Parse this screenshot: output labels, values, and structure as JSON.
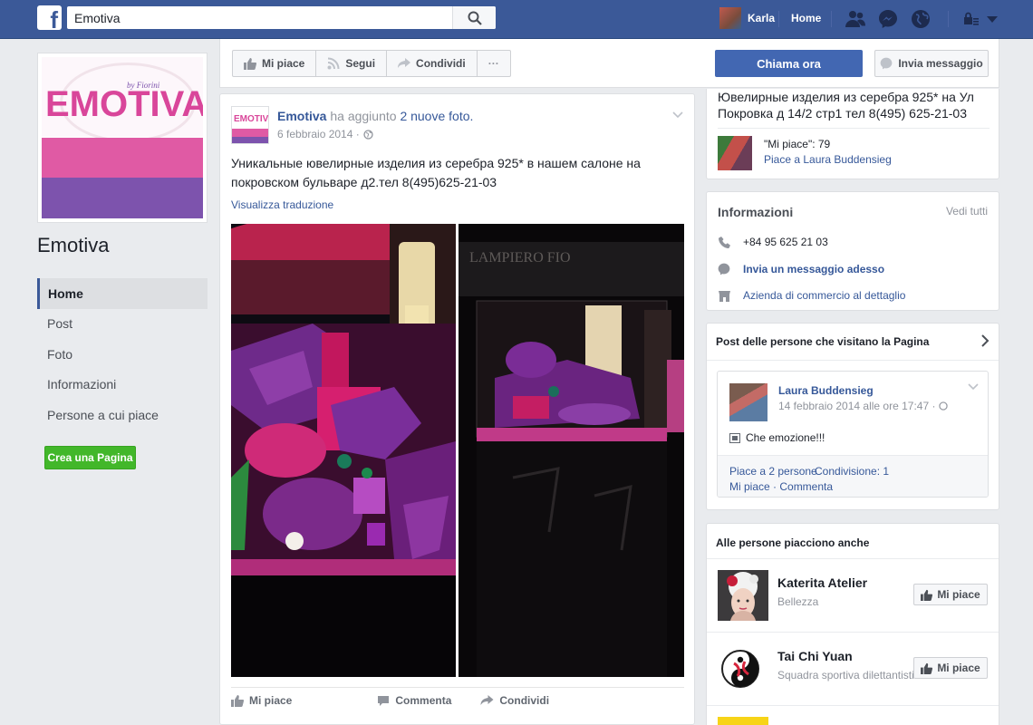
{
  "topbar": {
    "logo_letter": "f",
    "search_value": "Emotiva",
    "user_name": "Karla",
    "home_label": "Home",
    "colors": {
      "bar": "#3b5998"
    }
  },
  "left": {
    "logo_text": "EMOTIVA",
    "logo_by": "by Fiorini",
    "page_name": "Emotiva",
    "nav": [
      "Home",
      "Post",
      "Foto",
      "Informazioni",
      "Persone a cui piace"
    ],
    "create_page": "Crea una Pagina"
  },
  "actionbar": {
    "like": "Mi piace",
    "follow": "Segui",
    "share": "Condividi",
    "more": "···",
    "call": "Chiama ora",
    "message": "Invia messaggio"
  },
  "post": {
    "author": "Emotiva",
    "added": "ha aggiunto",
    "photos_link": "2 nuove foto.",
    "date": "6 febbraio 2014 ·",
    "text": "Уникальные ювелирные изделия из серебра 925* в нашем салоне на покровском бульваре д2.тел 8(495)625-21-03",
    "translate": "Visualizza traduzione",
    "actions": {
      "like": "Mi piace",
      "comment": "Commenta",
      "share": "Condividi"
    }
  },
  "right": {
    "address": "Ювелирные изделия из серебра 925* на Ул Покровка д 14/2 стр1 тел 8(495) 625-21-03",
    "likes_count": "\"Mi piace\": 79",
    "likes_by": "Piace a Laura Buddensieg",
    "info": {
      "title": "Informazioni",
      "see_all": "Vedi tutti",
      "phone": "+84 95 625 21 03",
      "send_message": "Invia un messaggio adesso",
      "category": "Azienda di commercio al dettaglio"
    },
    "visitors": {
      "title": "Post delle persone che visitano la Pagina",
      "name": "Laura Buddensieg",
      "date": "14 febbraio 2014 alle ore 17:47 ·",
      "text": "Che emozione!!!",
      "likes": "Piace a 2 persone",
      "shares": "Condivisione: 1",
      "links": "Mi piace · Commenta"
    },
    "also_like": {
      "title": "Alle persone piacciono anche",
      "items": [
        {
          "name": "Katerita Atelier",
          "sub": "Bellezza",
          "button": "Mi piace"
        },
        {
          "name": "Tai Chi Yuan",
          "sub": "Squadra sportiva dilettantistica",
          "button": "Mi piace"
        }
      ]
    }
  }
}
